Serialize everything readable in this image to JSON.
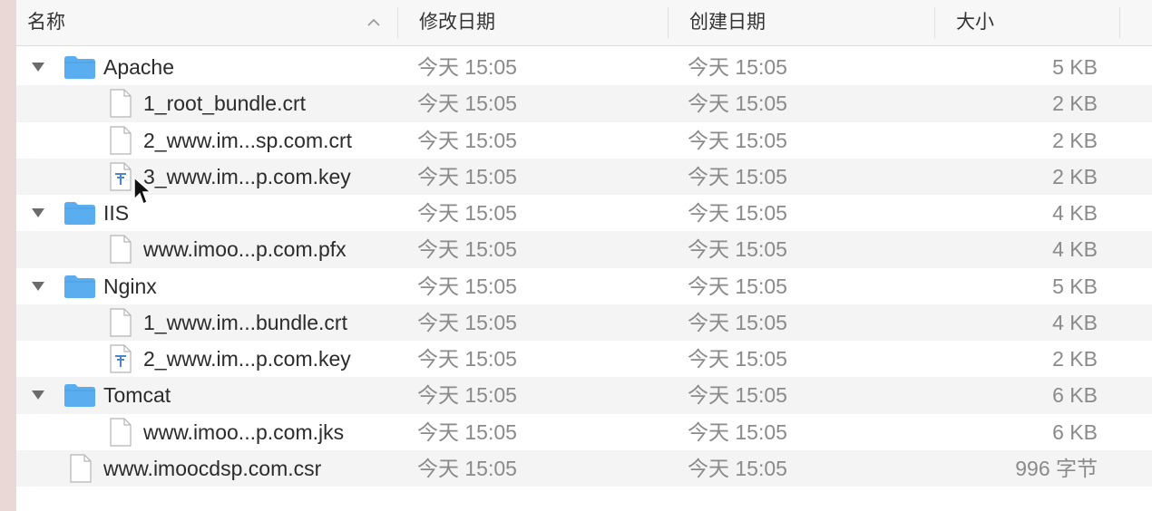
{
  "columns": {
    "name": "名称",
    "modified": "修改日期",
    "created": "创建日期",
    "size": "大小"
  },
  "rows": [
    {
      "kind": "folder",
      "indent": 0,
      "expanded": true,
      "name": "Apache",
      "modified": "今天 15:05",
      "created": "今天 15:05",
      "size": "5 KB"
    },
    {
      "kind": "file",
      "indent": 1,
      "icon": "document-icon",
      "name": "1_root_bundle.crt",
      "modified": "今天 15:05",
      "created": "今天 15:05",
      "size": "2 KB"
    },
    {
      "kind": "file",
      "indent": 1,
      "icon": "document-icon",
      "name": "2_www.im...sp.com.crt",
      "modified": "今天 15:05",
      "created": "今天 15:05",
      "size": "2 KB"
    },
    {
      "kind": "file",
      "indent": 1,
      "icon": "text-file-icon",
      "name": "3_www.im...p.com.key",
      "modified": "今天 15:05",
      "created": "今天 15:05",
      "size": "2 KB"
    },
    {
      "kind": "folder",
      "indent": 0,
      "expanded": true,
      "name": "IIS",
      "modified": "今天 15:05",
      "created": "今天 15:05",
      "size": "4 KB"
    },
    {
      "kind": "file",
      "indent": 1,
      "icon": "document-icon",
      "name": "www.imoo...p.com.pfx",
      "modified": "今天 15:05",
      "created": "今天 15:05",
      "size": "4 KB"
    },
    {
      "kind": "folder",
      "indent": 0,
      "expanded": true,
      "name": "Nginx",
      "modified": "今天 15:05",
      "created": "今天 15:05",
      "size": "5 KB"
    },
    {
      "kind": "file",
      "indent": 1,
      "icon": "document-icon",
      "name": "1_www.im...bundle.crt",
      "modified": "今天 15:05",
      "created": "今天 15:05",
      "size": "4 KB"
    },
    {
      "kind": "file",
      "indent": 1,
      "icon": "text-file-icon",
      "name": "2_www.im...p.com.key",
      "modified": "今天 15:05",
      "created": "今天 15:05",
      "size": "2 KB"
    },
    {
      "kind": "folder",
      "indent": 0,
      "expanded": true,
      "name": "Tomcat",
      "modified": "今天 15:05",
      "created": "今天 15:05",
      "size": "6 KB"
    },
    {
      "kind": "file",
      "indent": 1,
      "icon": "document-icon",
      "name": "www.imoo...p.com.jks",
      "modified": "今天 15:05",
      "created": "今天 15:05",
      "size": "6 KB"
    },
    {
      "kind": "file",
      "indent": 0,
      "icon": "document-icon",
      "name": "www.imoocdsp.com.csr",
      "modified": "今天 15:05",
      "created": "今天 15:05",
      "size": "996 字节"
    }
  ],
  "colors": {
    "folder": "#5aaef0",
    "alt_row": "#f4f4f5",
    "date_text": "#8a8a8a"
  }
}
